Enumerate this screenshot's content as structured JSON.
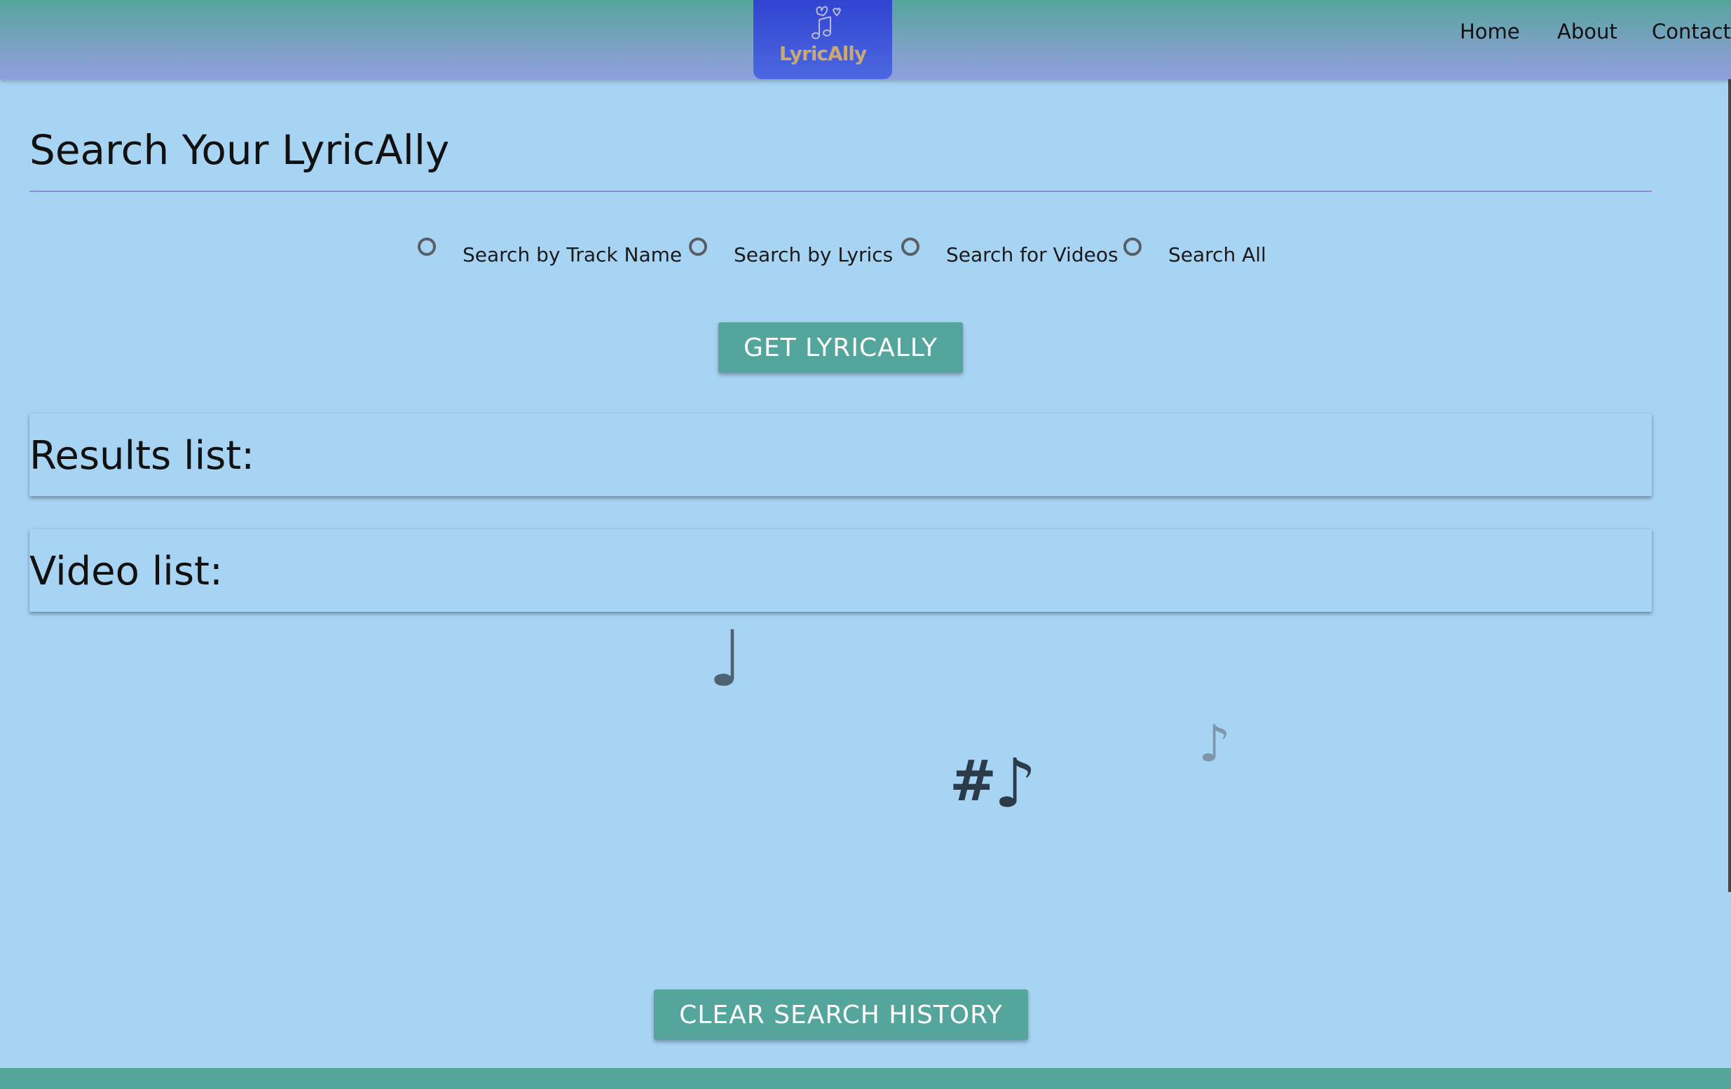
{
  "header": {
    "logo_text": "LyricAlly",
    "logo_icon": "music-notes-heart-icon",
    "nav": {
      "home": "Home",
      "about": "About",
      "contact": "Contact"
    }
  },
  "search": {
    "title": "Search Your LyricAlly",
    "options": [
      {
        "label": "Search by Track Name",
        "selected": false
      },
      {
        "label": "Search by Lyrics",
        "selected": false
      },
      {
        "label": "Search for Videos",
        "selected": false
      },
      {
        "label": "Search All",
        "selected": false
      }
    ],
    "submit_label": "GET LYRICALLY"
  },
  "results": {
    "heading": "Results list:"
  },
  "videos": {
    "heading": "Video list:"
  },
  "decor": {
    "quarter_note": "♩",
    "sharp": "#",
    "eighth_note_dark": "♪",
    "eighth_note_faded": "♪"
  },
  "footer_actions": {
    "clear_label": "CLEAR SEARCH HISTORY"
  },
  "colors": {
    "page_background": "#a8d4f4",
    "accent_button": "#54a59c",
    "header_top": "#55a59c",
    "header_bottom": "#8e9fdc",
    "logo_background": "#3044d0",
    "logo_text": "#c9a877",
    "title_rule": "#8e8ed8"
  }
}
